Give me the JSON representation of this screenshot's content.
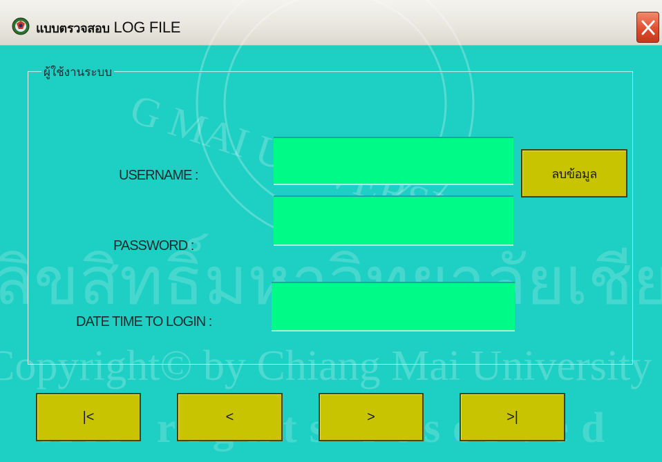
{
  "window": {
    "title_thai": "แบบตรวจสอบ",
    "title_latin": "LOG FILE",
    "close_label": "X"
  },
  "group": {
    "legend": "ผู้ใช้งานระบบ"
  },
  "form": {
    "username_label": "USERNAME :",
    "password_label": "PASSWORD :",
    "datetime_label": "DATE TIME TO LOGIN :",
    "username_value": "",
    "password_value": "",
    "datetime_value": ""
  },
  "buttons": {
    "clear": "ลบข้อมูล",
    "first": "|<",
    "prev": "<",
    "next": ">",
    "last": ">|"
  },
  "watermark": {
    "seal_text": "G  MAI  UNIVERSITY",
    "line1": "ลิขสิทธิ์มหาวิทยาลัยเชียงใหม่",
    "line2": "Copyright© by Chiang Mai University",
    "line3": "All rights reserved"
  },
  "colors": {
    "window_bg": "#1ecfc4",
    "field_bg": "#00fa88",
    "button_bg": "#c9c401",
    "close_bg": "#dd4a2a"
  },
  "icons": {
    "app": "app-logo-icon",
    "close": "close-icon"
  }
}
